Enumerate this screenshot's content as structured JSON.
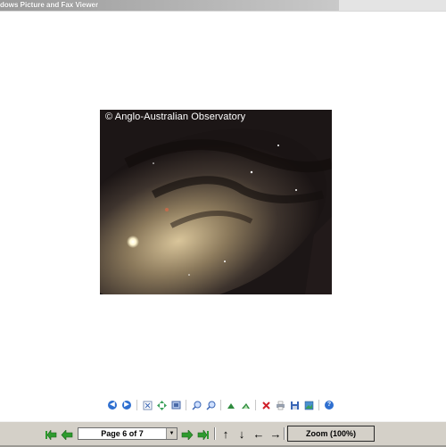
{
  "window": {
    "title": "dows Picture and Fax Viewer"
  },
  "image": {
    "copyright": "© Anglo-Australian Observatory",
    "description_icon": "milky-way-photo"
  },
  "viewer_toolbar": {
    "buttons": [
      {
        "name": "previous-image-button",
        "icon": "prev-circle-icon"
      },
      {
        "name": "next-image-button",
        "icon": "next-circle-icon"
      },
      {
        "name": "best-fit-button",
        "icon": "best-fit-icon"
      },
      {
        "name": "actual-size-button",
        "icon": "actual-size-icon"
      },
      {
        "name": "slideshow-button",
        "icon": "slideshow-icon"
      },
      {
        "name": "zoom-in-button",
        "icon": "zoom-in-icon"
      },
      {
        "name": "zoom-out-button",
        "icon": "zoom-out-icon"
      },
      {
        "name": "rotate-clockwise-button",
        "icon": "rotate-cw-icon"
      },
      {
        "name": "rotate-counterclockwise-button",
        "icon": "rotate-ccw-icon"
      },
      {
        "name": "delete-button",
        "icon": "delete-icon"
      },
      {
        "name": "print-button",
        "icon": "print-icon"
      },
      {
        "name": "save-button",
        "icon": "save-icon"
      },
      {
        "name": "open-editor-button",
        "icon": "editor-icon"
      },
      {
        "name": "help-button",
        "icon": "help-icon"
      }
    ]
  },
  "bottom_bar": {
    "page_label": "Page 6 of 7",
    "zoom_label": "Zoom (100%)"
  },
  "colors": {
    "nav_green": "#2e9b2e",
    "toolbar_blue": "#2e6fd0",
    "strip_bg": "#d4d0c8"
  }
}
